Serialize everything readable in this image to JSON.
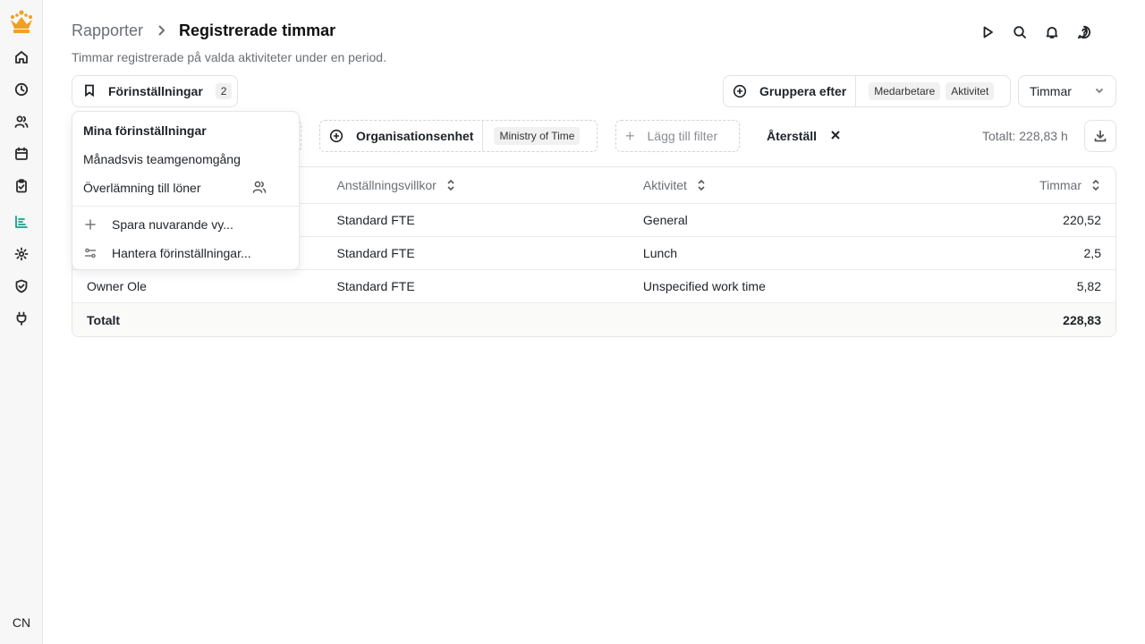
{
  "breadcrumb": {
    "parent": "Rapporter",
    "current": "Registrerade timmar"
  },
  "subtitle": "Timmar registrerade på valda aktiviteter under en period.",
  "presets": {
    "label": "Förinställningar",
    "count": "2"
  },
  "group_by": {
    "label": "Gruppera efter",
    "chips": [
      "Medarbetare",
      "Aktivitet"
    ]
  },
  "unit_select": {
    "value": "Timmar"
  },
  "filters": {
    "org_unit": {
      "label": "Organisationsenhet",
      "value": "Ministry of Time"
    },
    "add_filter": "Lägg till filter",
    "reset": "Återställ"
  },
  "total_summary": "Totalt: 228,83 h",
  "table": {
    "columns": [
      "Anställningsvillkor",
      "Aktivitet",
      "Timmar"
    ],
    "rows": [
      {
        "employee": "",
        "terms": "Standard FTE",
        "activity": "General",
        "hours": "220,52"
      },
      {
        "employee": "",
        "terms": "Standard FTE",
        "activity": "Lunch",
        "hours": "2,5"
      },
      {
        "employee": "Owner Ole",
        "terms": "Standard FTE",
        "activity": "Unspecified work time",
        "hours": "5,82"
      }
    ],
    "total": {
      "label": "Totalt",
      "hours": "228,83"
    }
  },
  "menu": {
    "header": "Mina förinställningar",
    "items": [
      "Månadsvis teamgenomgång",
      "Överlämning till löner"
    ],
    "actions": [
      "Spara nuvarande vy...",
      "Hantera förinställningar..."
    ]
  },
  "user": {
    "initials": "CN"
  },
  "colors": {
    "accent": "#1a9e8a",
    "logo": "#f0a020"
  },
  "icons": {
    "sidebar": [
      "home-icon",
      "clock-icon",
      "users-icon",
      "calendar-icon",
      "clipboard-icon",
      "reports-icon",
      "gear-icon",
      "shield-icon",
      "plug-icon"
    ],
    "top": [
      "play-icon",
      "search-icon",
      "bell-icon",
      "help-icon"
    ]
  }
}
